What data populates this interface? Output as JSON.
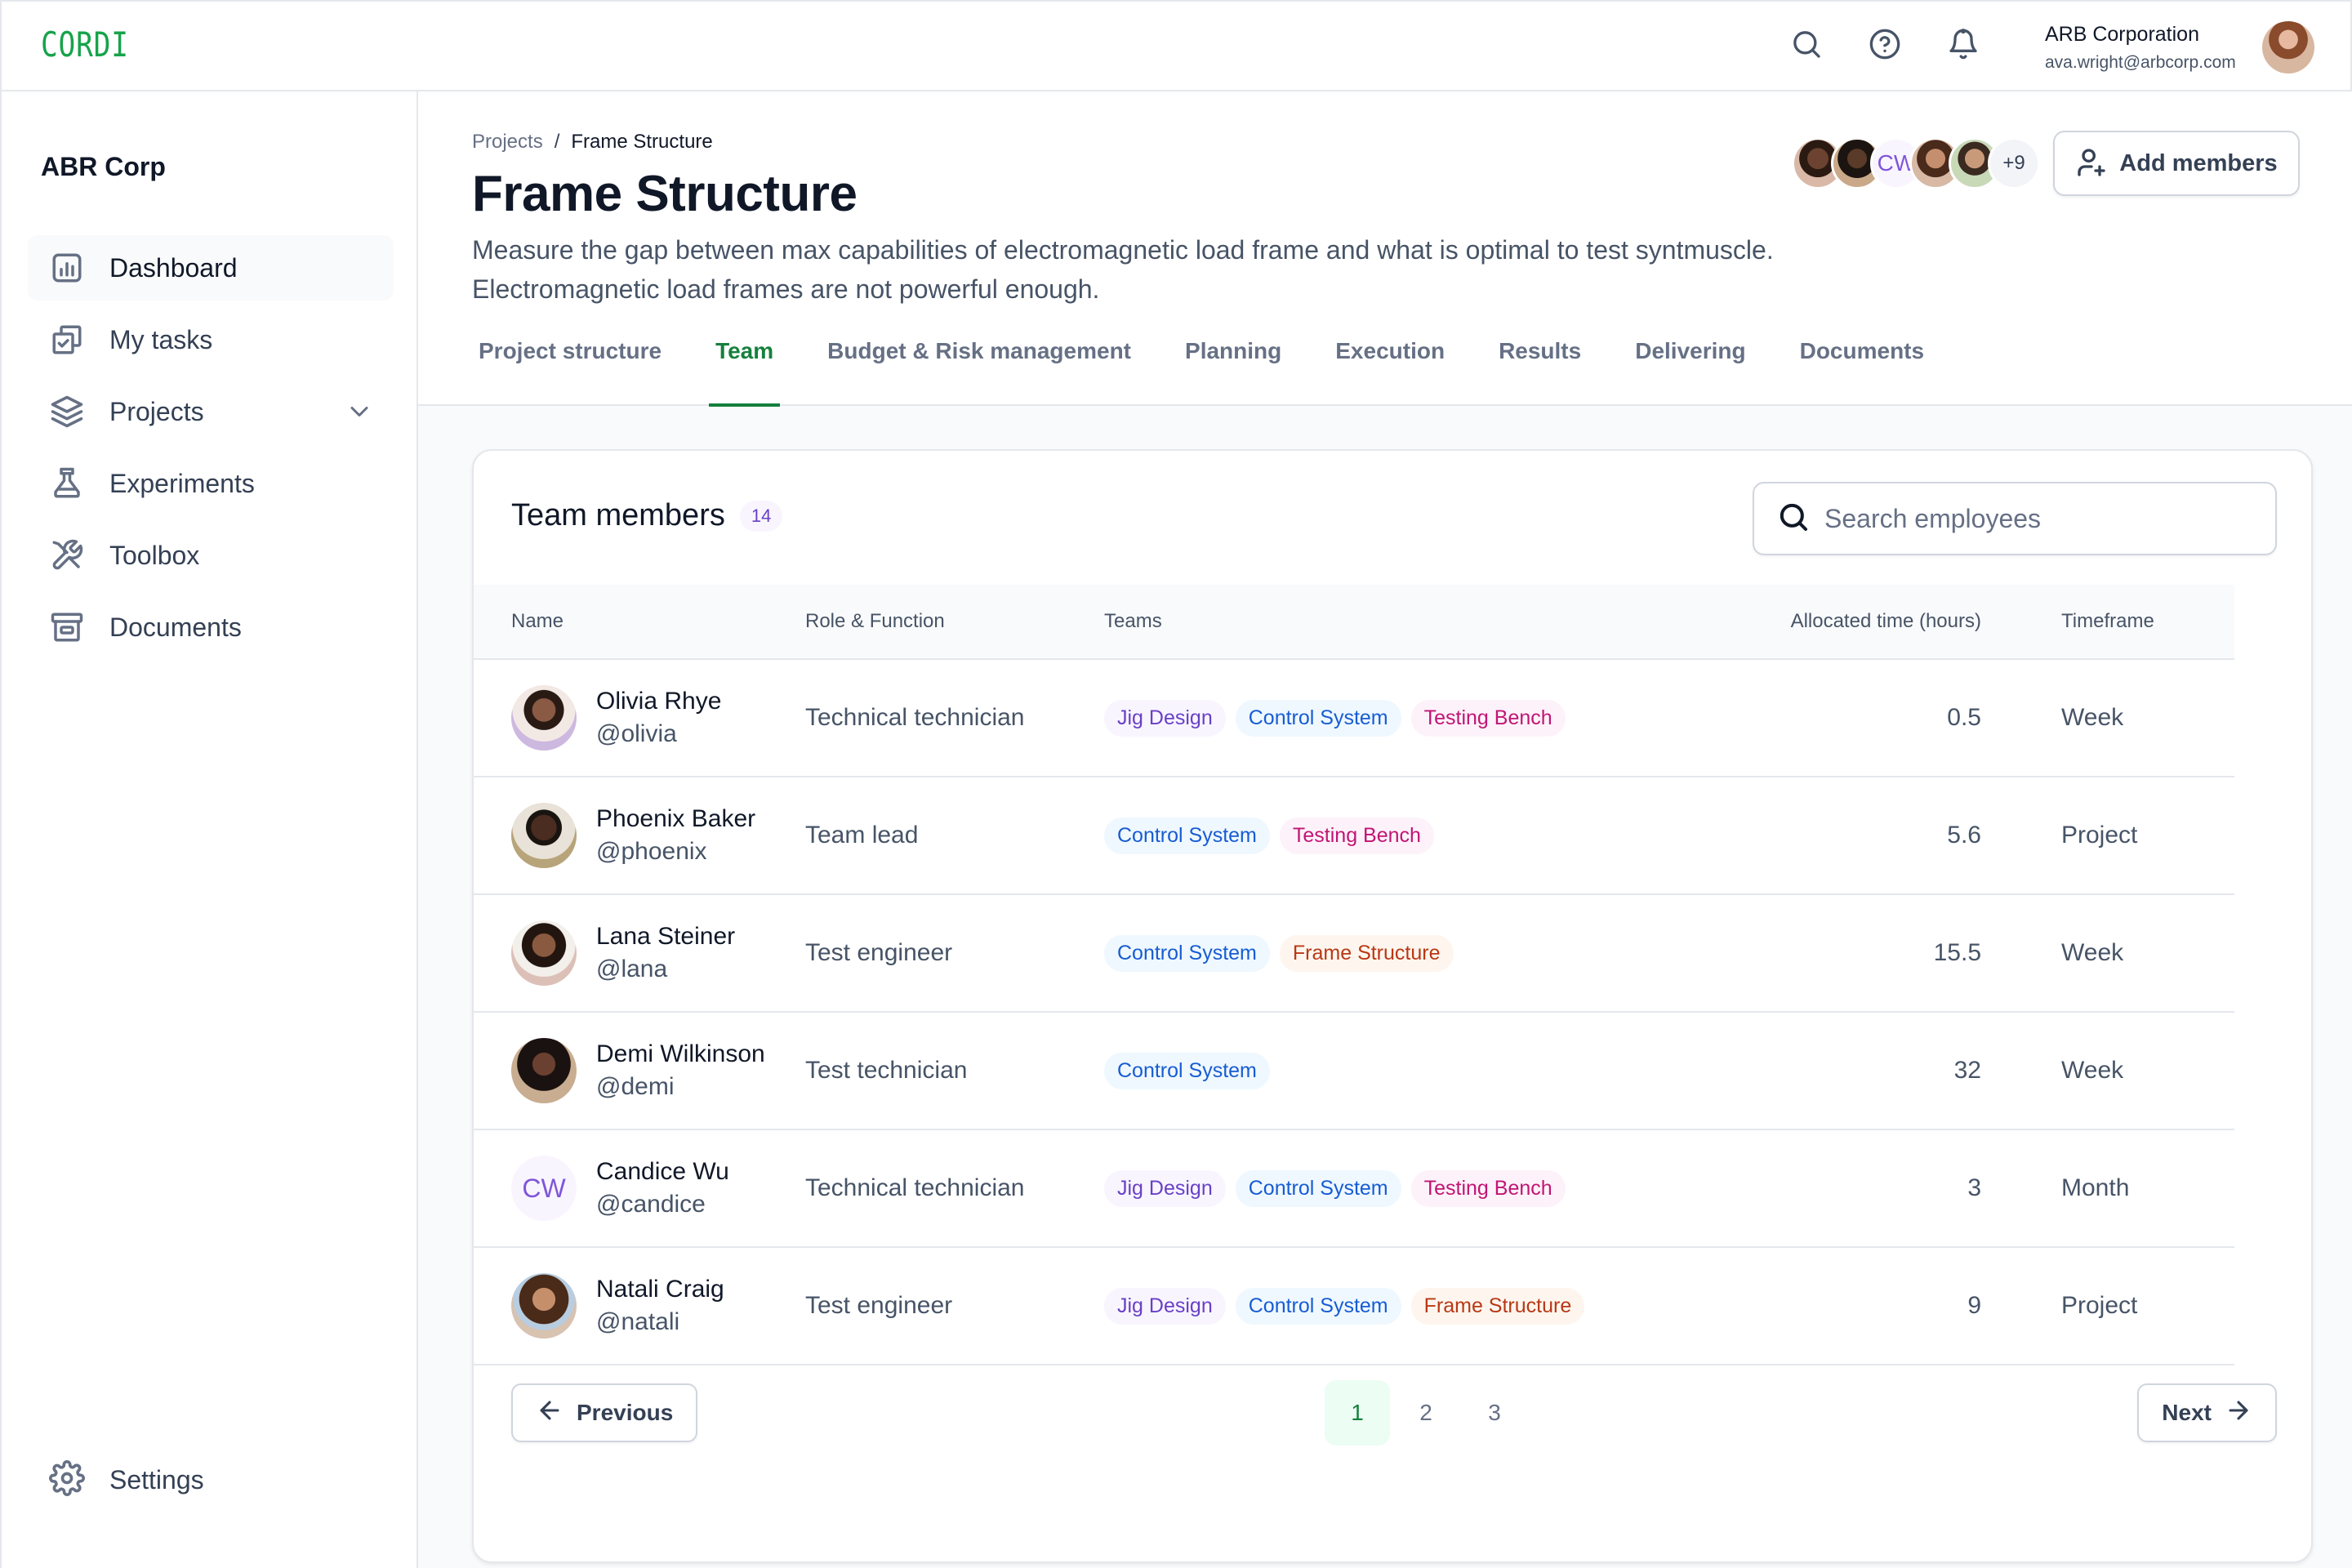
{
  "app": {
    "logo": "CORDI"
  },
  "topbar": {
    "icons": [
      "search-icon",
      "help-icon",
      "bell-icon"
    ],
    "user": {
      "org": "ARB Corporation",
      "email": "ava.wright@arbcorp.com"
    }
  },
  "sidebar": {
    "org_name": "ABR Corp",
    "items": [
      {
        "label": "Dashboard",
        "icon": "bar-chart-icon",
        "active": true
      },
      {
        "label": "My tasks",
        "icon": "tasks-icon"
      },
      {
        "label": "Projects",
        "icon": "layers-icon",
        "expandable": true
      },
      {
        "label": "Experiments",
        "icon": "flask-icon"
      },
      {
        "label": "Toolbox",
        "icon": "tools-icon"
      },
      {
        "label": "Documents",
        "icon": "archive-icon"
      }
    ],
    "settings_label": "Settings"
  },
  "header": {
    "breadcrumb": {
      "parent": "Projects",
      "separator": "/",
      "current": "Frame Structure"
    },
    "title": "Frame Structure",
    "description": "Measure the gap between max capabilities of electromagnetic load frame and what is optimal to test syntmuscle. Electromagnetic load frames are not powerful enough.",
    "avatar_stack": {
      "initials": "CW",
      "more": "+9"
    },
    "add_members_label": "Add members",
    "tabs": [
      {
        "label": "Project structure"
      },
      {
        "label": "Team",
        "active": true
      },
      {
        "label": "Budget & Risk management"
      },
      {
        "label": "Planning"
      },
      {
        "label": "Execution"
      },
      {
        "label": "Results"
      },
      {
        "label": "Delivering"
      },
      {
        "label": "Documents"
      }
    ]
  },
  "team": {
    "title": "Team members",
    "count": "14",
    "search_placeholder": "Search employees",
    "search_value": "",
    "columns": {
      "name": "Name",
      "role": "Role & Function",
      "teams": "Teams",
      "time": "Allocated time (hours)",
      "timeframe": "Timeframe"
    },
    "rows": [
      {
        "name": "Olivia Rhye",
        "handle": "@olivia",
        "role": "Technical technician",
        "teams": [
          "Jig Design",
          "Control System",
          "Testing Bench"
        ],
        "time": "0.5",
        "timeframe": "Week"
      },
      {
        "name": "Phoenix Baker",
        "handle": "@phoenix",
        "role": "Team lead",
        "teams": [
          "Control System",
          "Testing Bench"
        ],
        "time": "5.6",
        "timeframe": "Project"
      },
      {
        "name": "Lana Steiner",
        "handle": "@lana",
        "role": "Test engineer",
        "teams": [
          "Control System",
          "Frame Structure"
        ],
        "time": "15.5",
        "timeframe": "Week"
      },
      {
        "name": "Demi Wilkinson",
        "handle": "@demi",
        "role": "Test technician",
        "teams": [
          "Control System"
        ],
        "time": "32",
        "timeframe": "Week"
      },
      {
        "name": "Candice Wu",
        "handle": "@candice",
        "initials": "CW",
        "role": "Technical technician",
        "teams": [
          "Jig Design",
          "Control System",
          "Testing Bench"
        ],
        "time": "3",
        "timeframe": "Month"
      },
      {
        "name": "Natali Craig",
        "handle": "@natali",
        "role": "Test engineer",
        "teams": [
          "Jig Design",
          "Control System",
          "Frame Structure"
        ],
        "time": "9",
        "timeframe": "Project"
      }
    ],
    "pagination": {
      "previous": "Previous",
      "next": "Next",
      "pages": [
        "1",
        "2",
        "3"
      ],
      "current": "1"
    }
  },
  "colors": {
    "brand": "#16a34a",
    "accent": "#15803d"
  }
}
